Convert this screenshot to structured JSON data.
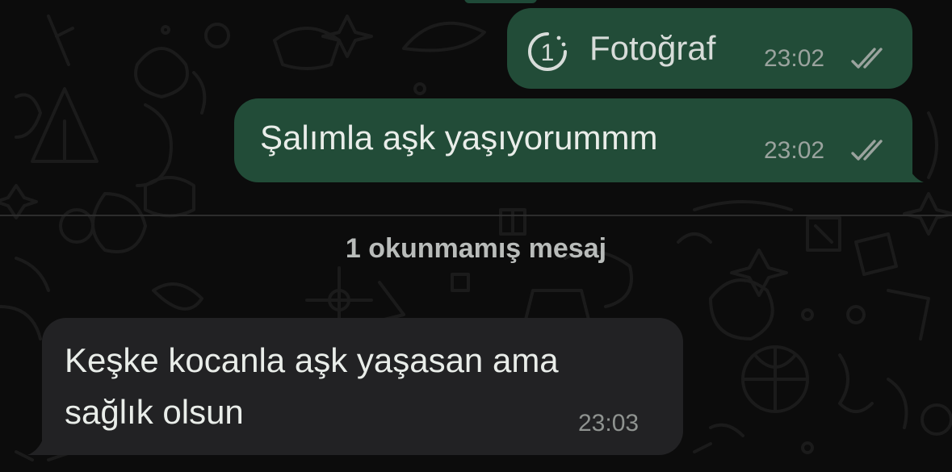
{
  "chat": {
    "messages": [
      {
        "direction": "outgoing",
        "type": "view-once-photo",
        "icon": "view-once-icon",
        "badge": "1",
        "text": "Fotoğraf",
        "time": "23:02",
        "status": "read"
      },
      {
        "direction": "outgoing",
        "type": "text",
        "text": "Şalımla aşk yaşıyorummm",
        "time": "23:02",
        "status": "read"
      },
      {
        "direction": "incoming",
        "type": "text",
        "lines": [
          "Keşke kocanla aşk yaşasan ama",
          "sağlık olsun"
        ],
        "time": "23:03"
      }
    ],
    "unread_divider": "1 okunmamış mesaj"
  },
  "colors": {
    "background": "#0c0c0c",
    "outgoing_bubble": "#224c38",
    "incoming_bubble": "#222224",
    "text": "#e9ede9",
    "timestamp": "#9aa39e",
    "divider_text": "#b9bcba"
  }
}
